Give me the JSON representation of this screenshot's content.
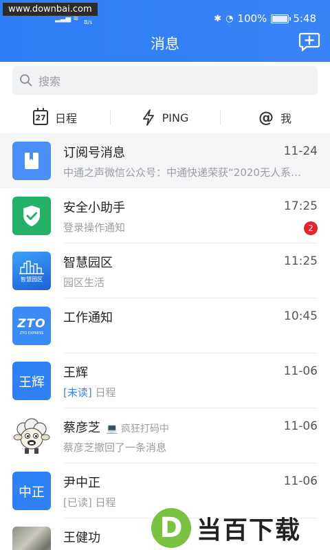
{
  "status_bar": {
    "watermark": "www.downbai.com",
    "net_speed": "B/s",
    "battery": "100%",
    "time": "5:48"
  },
  "header": {
    "title": "消息",
    "compose_icon": "compose-chat-icon",
    "bg_color": "#2f7cf6"
  },
  "search": {
    "placeholder": "搜索"
  },
  "tabs": [
    {
      "label": "日程",
      "icon": "calendar-icon",
      "icon_text": "27"
    },
    {
      "label": "PING",
      "icon": "lightning-icon"
    },
    {
      "label": "我",
      "icon": "at-icon",
      "icon_text": "@"
    }
  ],
  "conversations": [
    {
      "name": "订阅号消息",
      "time": "11-24",
      "preview": "中通之声微信公众号：中通快递荣获“2020无人系…",
      "avatar": "bookmark-icon",
      "pinned": true
    },
    {
      "name": "安全小助手",
      "time": "17:25",
      "preview": "登录操作通知",
      "avatar": "shield-check-icon",
      "badge": "2"
    },
    {
      "name": "智慧园区",
      "time": "11:25",
      "preview": "园区生活",
      "avatar": "city-icon",
      "avatar_text": "智慧园区"
    },
    {
      "name": "工作通知",
      "time": "10:45",
      "preview": "",
      "avatar": "zto-logo",
      "avatar_text": "ZTO",
      "avatar_sub": "ZTO EXPRESS"
    },
    {
      "name": "王辉",
      "time": "11-06",
      "tag": "[未读]",
      "preview": "日程",
      "avatar_text": "王辉"
    },
    {
      "name": "蔡彦芝",
      "time": "11-06",
      "status": "疯狂打码中",
      "preview": "蔡彦芝撤回了一条消息",
      "avatar": "sheep-avatar"
    },
    {
      "name": "尹中正",
      "time": "11-06",
      "tag": "[已读]",
      "preview": "日程",
      "avatar_text": "中正"
    },
    {
      "name": "王健功",
      "time": "",
      "preview": "",
      "avatar": "photo-avatar"
    }
  ],
  "watermark_bottom": {
    "logo_letter": "D",
    "text": "当百下载"
  }
}
